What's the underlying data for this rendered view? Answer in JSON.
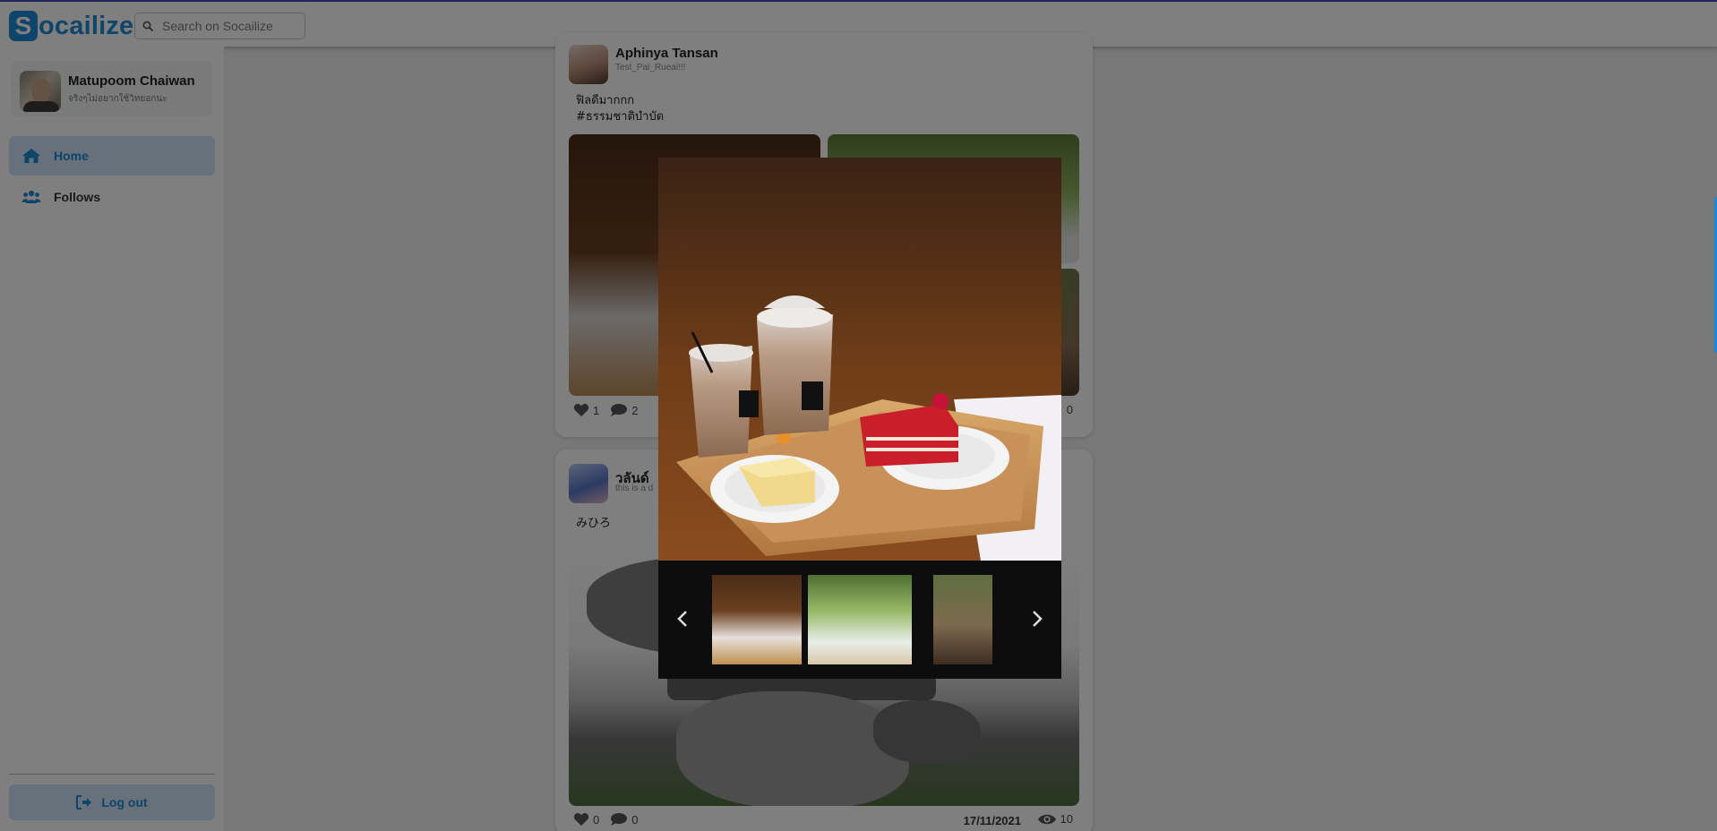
{
  "app": {
    "logo_letter": "S",
    "logo_rest": "ocailize",
    "brand_color": "#1e88d6"
  },
  "search": {
    "placeholder": "Search on Socailize"
  },
  "profile": {
    "name": "Matupoom Chaiwan",
    "subtitle": "จริงๆไม่อยากใช้วิทยอกนะ"
  },
  "nav": {
    "items": [
      {
        "label": "Home",
        "icon": "home-icon",
        "active": true
      },
      {
        "label": "Follows",
        "icon": "users-icon",
        "active": false
      }
    ],
    "logout_label": "Log out"
  },
  "posts": [
    {
      "author": "Aphinya Tansan",
      "handle": "Test_Pai_Rueai!!!",
      "text": "ฟิลดีมากกก\n#ธรรมชาติบำบัด",
      "likes": "1",
      "comments": "2",
      "views": "0"
    },
    {
      "author": "วลันด์ ",
      "handle": "this is a d",
      "text": "みひろ",
      "likes": "0",
      "comments": "0",
      "date": "17/11/2021",
      "views": "10"
    }
  ],
  "lightbox": {
    "image_count": 3,
    "selected_index": 0,
    "prev_icon": "chevron-left-icon",
    "next_icon": "chevron-right-icon"
  }
}
